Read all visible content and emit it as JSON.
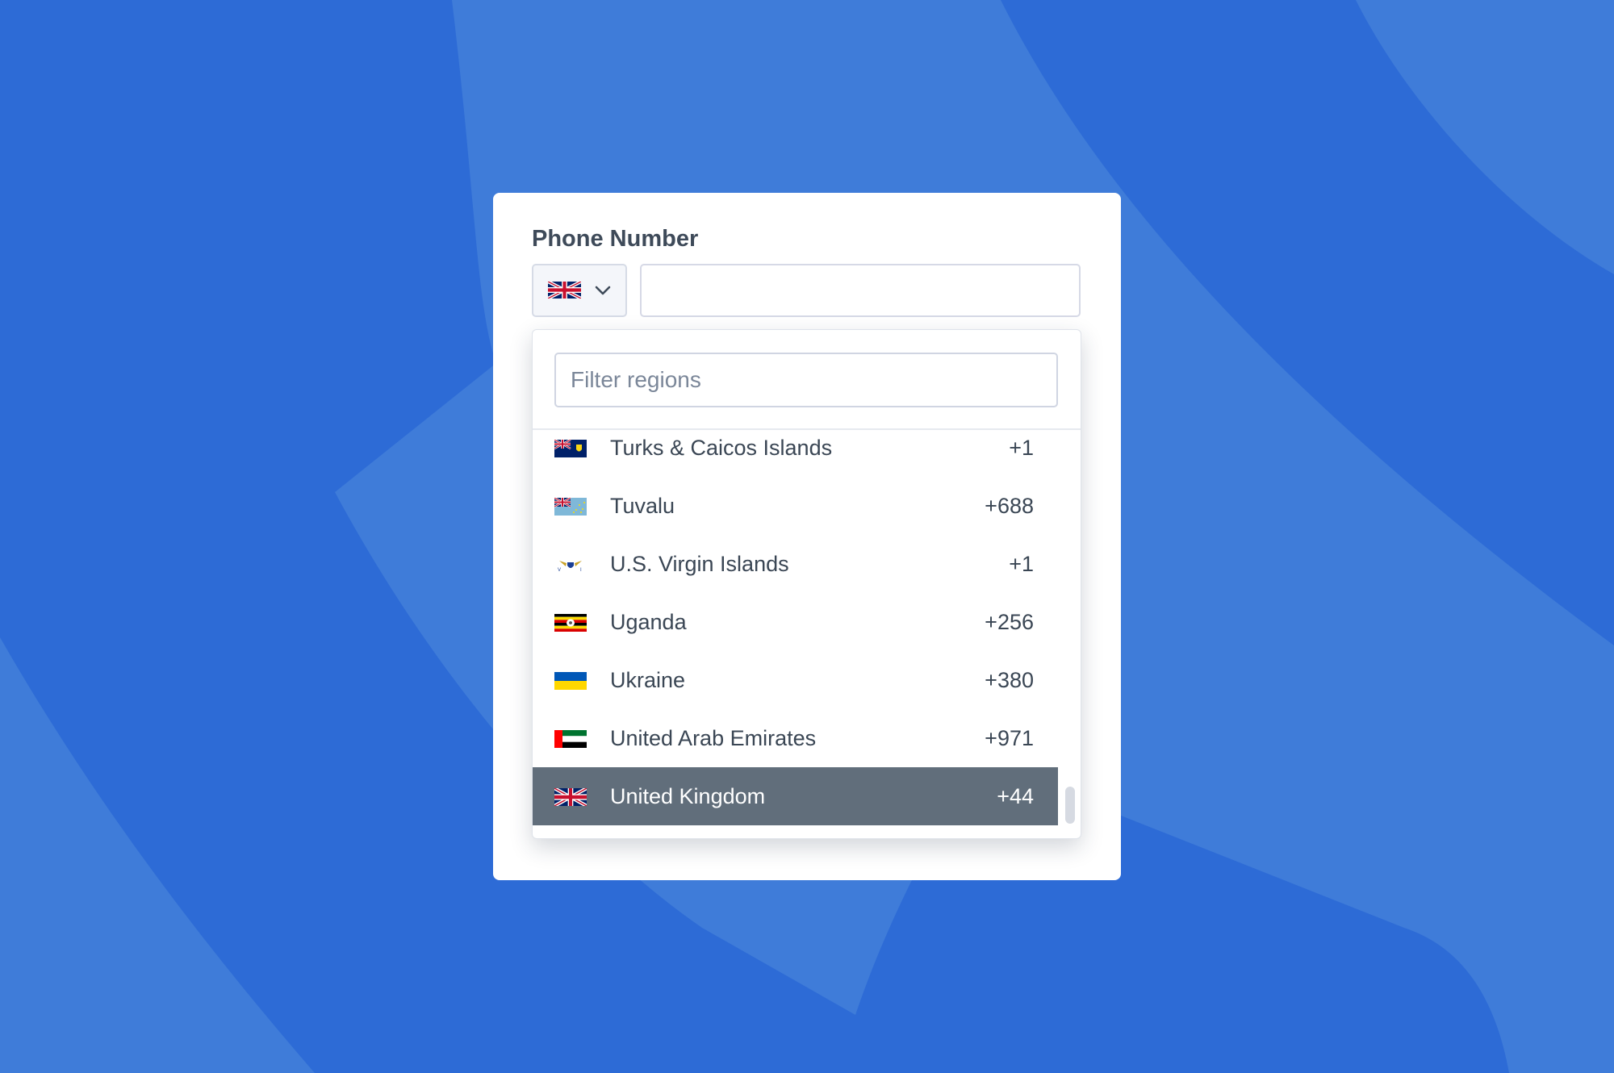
{
  "colors": {
    "background": "#2d6bd6",
    "background_waves": "#3f7cd9",
    "selected_row": "#616e7b",
    "text": "#3a4654"
  },
  "form": {
    "label": "Phone Number",
    "selected_country": {
      "name": "United Kingdom",
      "flag": "gb-flag-icon"
    },
    "phone_value": ""
  },
  "dropdown": {
    "filter_placeholder": "Filter regions",
    "filter_value": "",
    "items": [
      {
        "name": "Turks & Caicos Islands",
        "code": "+1",
        "flag": "tc-flag-icon",
        "selected": false
      },
      {
        "name": "Tuvalu",
        "code": "+688",
        "flag": "tv-flag-icon",
        "selected": false
      },
      {
        "name": "U.S. Virgin Islands",
        "code": "+1",
        "flag": "vi-flag-icon",
        "selected": false
      },
      {
        "name": "Uganda",
        "code": "+256",
        "flag": "ug-flag-icon",
        "selected": false
      },
      {
        "name": "Ukraine",
        "code": "+380",
        "flag": "ua-flag-icon",
        "selected": false
      },
      {
        "name": "United Arab Emirates",
        "code": "+971",
        "flag": "ae-flag-icon",
        "selected": false
      },
      {
        "name": "United Kingdom",
        "code": "+44",
        "flag": "gb-flag-icon",
        "selected": true
      }
    ]
  }
}
